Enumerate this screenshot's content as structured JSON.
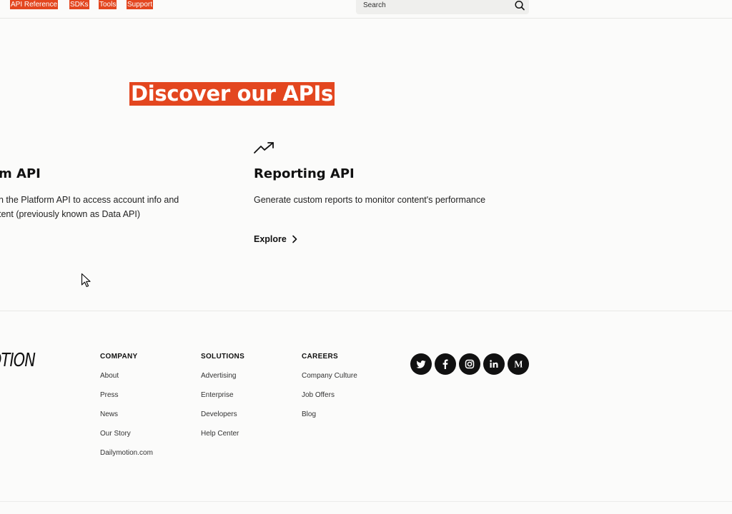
{
  "nav": {
    "links": [
      "API Reference",
      "SDKs",
      "Tools",
      "Support"
    ],
    "search_placeholder": "Search"
  },
  "hero": {
    "title": "Discover our APIs"
  },
  "cards": [
    {
      "title": "m API",
      "desc_line1": "n the Platform API to access account info and",
      "desc_line2": "tent (previously known as Data API)"
    },
    {
      "title": "Reporting API",
      "desc_line1": "Generate custom reports to monitor content's performance",
      "explore_label": "Explore",
      "icon": "trending-up-icon"
    }
  ],
  "footer": {
    "logo": "OTION",
    "columns": [
      {
        "heading": "COMPANY",
        "links": [
          "About",
          "Press",
          "News",
          "Our Story",
          "Dailymotion.com"
        ]
      },
      {
        "heading": "SOLUTIONS",
        "links": [
          "Advertising",
          "Enterprise",
          "Developers",
          "Help Center"
        ]
      },
      {
        "heading": "CAREERS",
        "links": [
          "Company Culture",
          "Job Offers",
          "Blog"
        ]
      }
    ],
    "socials": [
      "twitter-icon",
      "facebook-icon",
      "instagram-icon",
      "linkedin-icon",
      "medium-icon"
    ]
  },
  "colors": {
    "accent": "#e3461f",
    "background": "#fbfbfa",
    "text": "#111111"
  }
}
